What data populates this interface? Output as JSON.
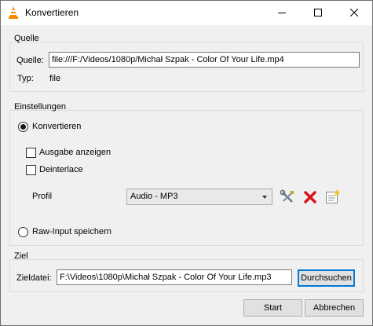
{
  "window": {
    "title": "Konvertieren",
    "accent_color": "#0078d7"
  },
  "source": {
    "group_title": "Quelle",
    "source_label": "Quelle:",
    "source_value": "file:///F:/Videos/1080p/Michał Szpak - Color Of Your Life.mp4",
    "type_label": "Typ:",
    "type_value": "file"
  },
  "settings": {
    "group_title": "Einstellungen",
    "convert_label": "Konvertieren",
    "convert_selected": true,
    "show_output_label": "Ausgabe anzeigen",
    "show_output_checked": false,
    "deinterlace_label": "Deinterlace",
    "deinterlace_checked": false,
    "profile_label": "Profil",
    "profile_selected": "Audio - MP3",
    "profile_tools": [
      "wrench-screwdriver-icon",
      "delete-x-icon",
      "new-profile-icon"
    ],
    "raw_input_label": "Raw-Input speichern",
    "raw_input_selected": false
  },
  "target": {
    "group_title": "Ziel",
    "file_label": "Zieldatei:",
    "file_value": "F:\\Videos\\1080p\\Michał Szpak - Color Of Your Life.mp3",
    "browse_label": "Durchsuchen"
  },
  "footer": {
    "start_label": "Start",
    "cancel_label": "Abbrechen"
  }
}
